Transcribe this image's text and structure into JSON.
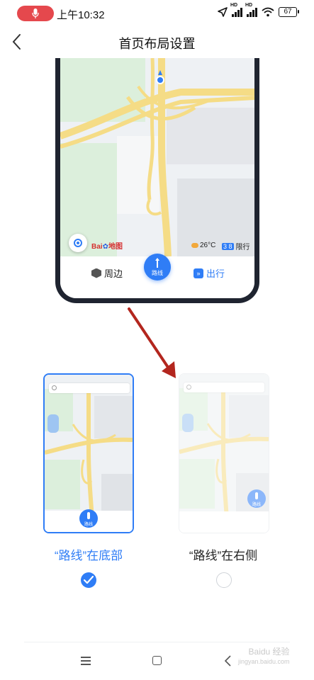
{
  "status_bar": {
    "time": "上午10:32",
    "battery": "67",
    "signal_tag": "HD"
  },
  "header": {
    "title": "首页布局设置"
  },
  "preview": {
    "weather": "26°C",
    "limit_badge": "3 8",
    "limit_label": "限行",
    "brand": "Bai",
    "brand_tail": "地图",
    "nearby_label": "周边",
    "route_label": "路线",
    "travel_label": "出行"
  },
  "options": [
    {
      "label": "“路线”在底部",
      "selected": true,
      "fab_label": "路线"
    },
    {
      "label": "“路线”在右侧",
      "selected": false,
      "fab_label": "路线"
    }
  ],
  "watermark": {
    "line1": "Baidu 经验",
    "line2": "jingyan.baidu.com"
  },
  "colors": {
    "accent": "#2f7df6",
    "annotation_arrow": "#b3261e",
    "mic_pill": "#e5484d"
  }
}
